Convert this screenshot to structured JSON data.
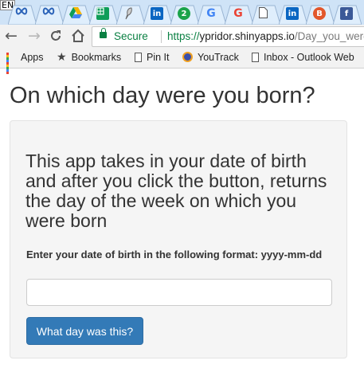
{
  "browser": {
    "input_indicator": "EN",
    "tabs": [
      {
        "icon": "infinity-icon"
      },
      {
        "icon": "infinity-icon"
      },
      {
        "icon": "google-drive-icon"
      },
      {
        "icon": "google-sheets-icon"
      },
      {
        "icon": "quill-icon"
      },
      {
        "icon": "linkedin-icon",
        "letter": "in"
      },
      {
        "icon": "green-circle-icon",
        "letter": "2"
      },
      {
        "icon": "google-icon",
        "letter": "G"
      },
      {
        "icon": "google-icon",
        "letter": "G"
      },
      {
        "icon": "document-icon"
      },
      {
        "icon": "linkedin-icon",
        "letter": "in"
      },
      {
        "icon": "b-badge-icon",
        "letter": "B"
      },
      {
        "icon": "facebook-icon",
        "letter": "f"
      }
    ],
    "toolbar": {
      "secure_label": "Secure",
      "url_scheme": "https://",
      "url_host": "ypridor.shinyapps.io",
      "url_path": "/Day_you_were_born/"
    },
    "bookmarks": [
      {
        "label": "Apps",
        "icon": "apps-grid-icon"
      },
      {
        "label": "Bookmarks",
        "icon": "star-icon"
      },
      {
        "label": "Pin It",
        "icon": "document-icon"
      },
      {
        "label": "YouTrack",
        "icon": "youtrack-icon"
      },
      {
        "label": "Inbox - Outlook Web",
        "icon": "document-icon"
      }
    ]
  },
  "page": {
    "title": "On which day were you born?",
    "description": "This app takes in your date of birth and after you click the button, returns the day of the week on which you were born",
    "input_label": "Enter your date of birth in the following format: yyyy-mm-dd",
    "input_value": "",
    "button_label": "What day was this?"
  },
  "colors": {
    "button": "#337ab7",
    "secure_green": "#0b8043",
    "tabstrip": "#cfe3f7"
  }
}
